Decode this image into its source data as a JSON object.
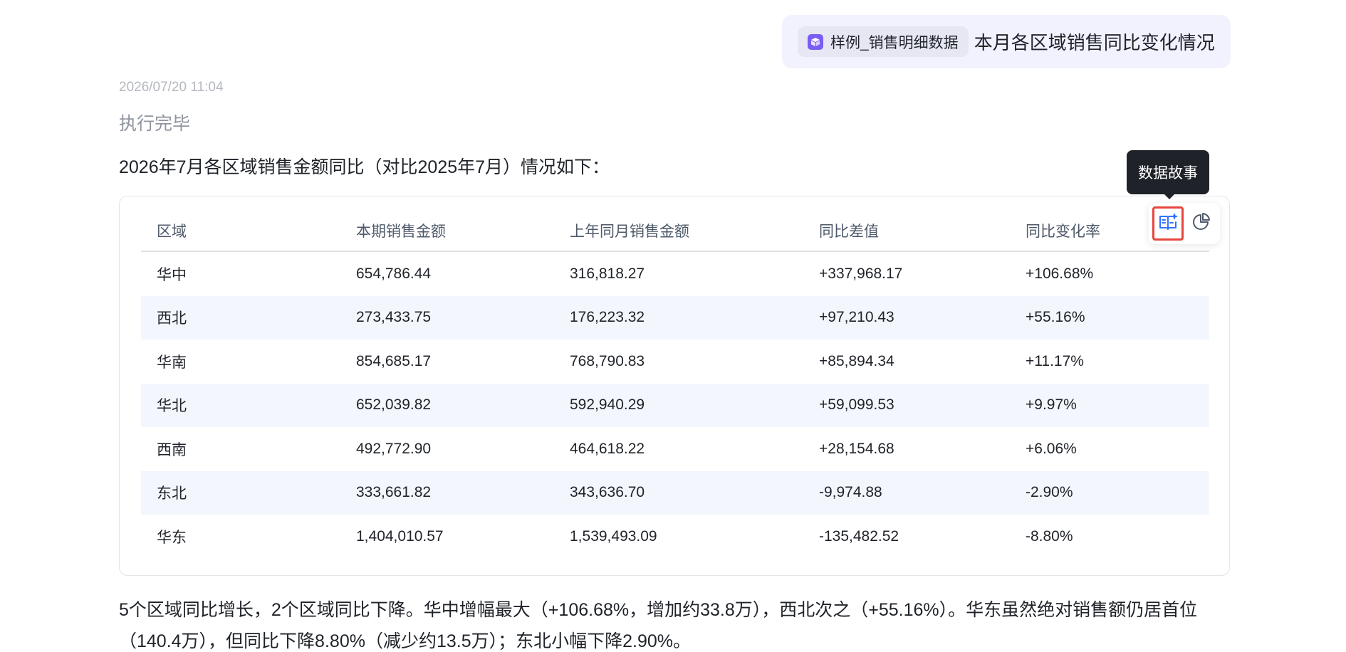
{
  "question": {
    "dataset_label": "样例_销售明细数据",
    "text": "本月各区域销售同比变化情况"
  },
  "answer": {
    "timestamp": "2026/07/20 11:04",
    "status": "执行完毕",
    "intro": "2026年7月各区域销售金额同比（对比2025年7月）情况如下：",
    "table": {
      "headers": [
        "区域",
        "本期销售金额",
        "上年同月销售金额",
        "同比差值",
        "同比变化率"
      ],
      "rows": [
        [
          "华中",
          "654,786.44",
          "316,818.27",
          "+337,968.17",
          "+106.68%"
        ],
        [
          "西北",
          "273,433.75",
          "176,223.32",
          "+97,210.43",
          "+55.16%"
        ],
        [
          "华南",
          "854,685.17",
          "768,790.83",
          "+85,894.34",
          "+11.17%"
        ],
        [
          "华北",
          "652,039.82",
          "592,940.29",
          "+59,099.53",
          "+9.97%"
        ],
        [
          "西南",
          "492,772.90",
          "464,618.22",
          "+28,154.68",
          "+6.06%"
        ],
        [
          "东北",
          "333,661.82",
          "343,636.70",
          "-9,974.88",
          "-2.90%"
        ],
        [
          "华东",
          "1,404,010.57",
          "1,539,493.09",
          "-135,482.52",
          "-8.80%"
        ]
      ]
    },
    "actions": {
      "data_story_icon": "book-sparkle-icon",
      "chart_icon": "pie-chart-icon",
      "tooltip": "数据故事"
    },
    "summary": "5个区域同比增长，2个区域同比下降。华中增幅最大（+106.68%，增加约33.8万），西北次之（+55.16%）。华东虽然绝对销售额仍居首位（140.4万），但同比下降8.80%（减少约13.5万）；东北小幅下降2.90%。"
  },
  "colors": {
    "accent": "#7b5cf5",
    "highlight_border": "#e8453c",
    "icon_blue": "#3370ff",
    "row_alt": "#f3f6fd"
  }
}
